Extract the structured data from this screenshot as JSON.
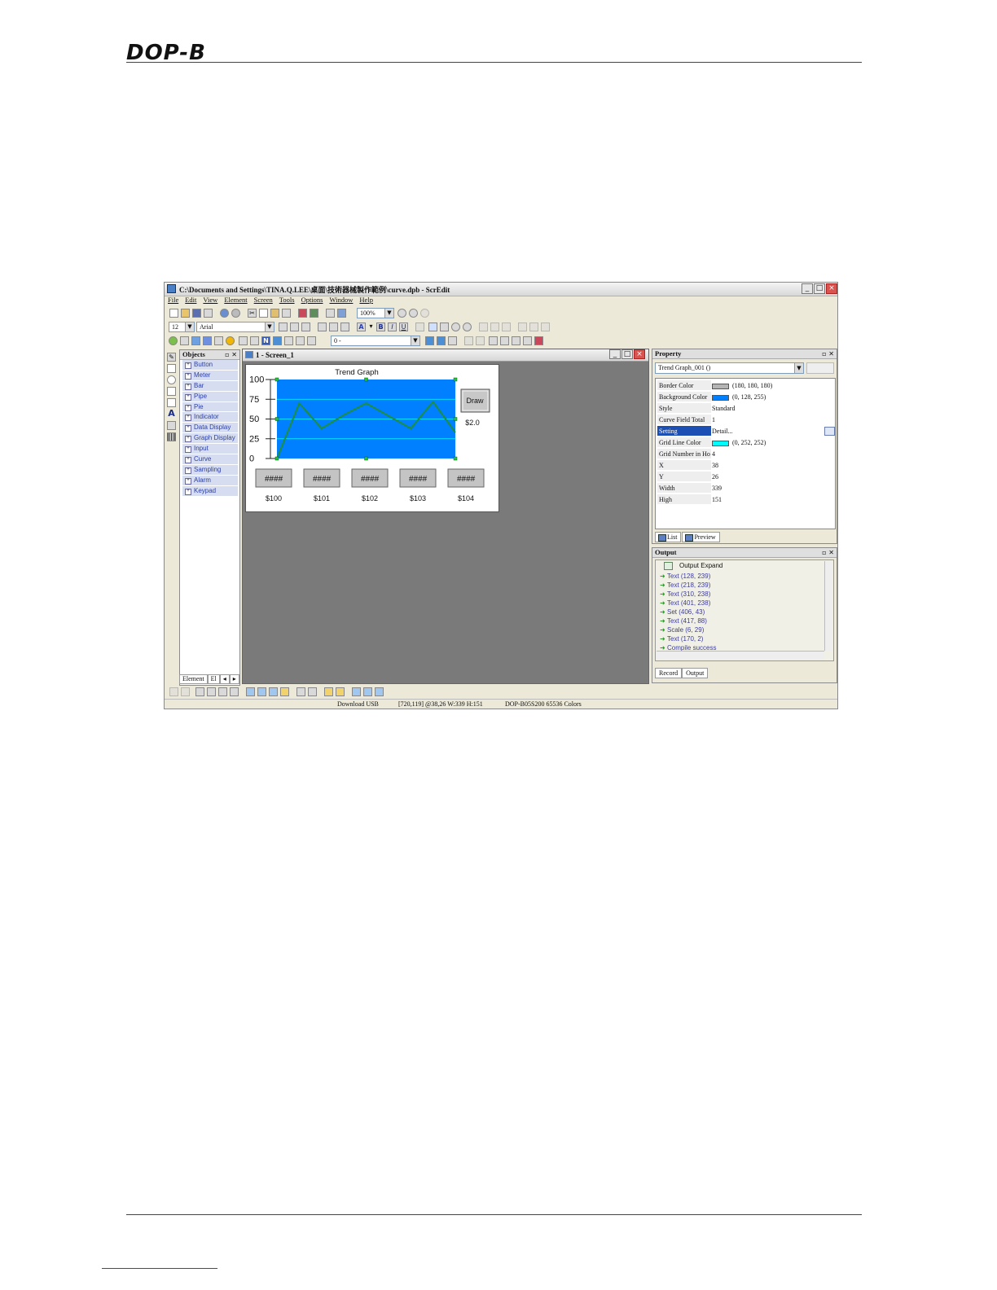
{
  "page": {
    "logo": "DOP-B"
  },
  "window": {
    "title": "C:\\Documents and Settings\\TINA.Q.LEE\\桌面\\技術器械製作範例\\curve.dpb - ScrEdit",
    "minimize": "_",
    "maximize": "□",
    "close": "×"
  },
  "menu": [
    "File",
    "Edit",
    "View",
    "Element",
    "Screen",
    "Tools",
    "Options",
    "Window",
    "Help"
  ],
  "toolbar": {
    "zoom_value": "100%",
    "font_size_value": "12",
    "font_name_value": "Arial",
    "state_value": "0 -",
    "bold": "B",
    "italic": "I",
    "underline": "U",
    "font_color": "A",
    "num": "N"
  },
  "objects_panel": {
    "title": "Objects",
    "items": [
      "Button",
      "Meter",
      "Bar",
      "Pipe",
      "Pie",
      "Indicator",
      "Data Display",
      "Graph Display",
      "Input",
      "Curve",
      "Sampling",
      "Alarm",
      "Keypad"
    ],
    "tab_element": "Element",
    "tab_more": "El"
  },
  "screen_window": {
    "title": "1 - Screen_1"
  },
  "trend_graph": {
    "title": "Trend Graph",
    "draw_button": "Draw",
    "draw_address": "$2.0",
    "displays": [
      {
        "value": "####",
        "address": "$100"
      },
      {
        "value": "####",
        "address": "$101"
      },
      {
        "value": "####",
        "address": "$102"
      },
      {
        "value": "####",
        "address": "$103"
      },
      {
        "value": "####",
        "address": "$104"
      }
    ],
    "background_color": "#0080ff",
    "grid_color": "#00fcfc",
    "curve_color": "#1f8f3a"
  },
  "chart_data": {
    "type": "line",
    "title": "Trend Graph",
    "yticks": [
      "100",
      "75",
      "50",
      "25",
      "0"
    ],
    "ylim": [
      0,
      100
    ],
    "x": [
      0,
      1,
      2,
      3,
      4,
      5,
      6,
      7,
      8
    ],
    "series": [
      {
        "values": [
          0,
          70,
          38,
          55,
          70,
          54,
          38,
          72,
          33
        ]
      }
    ]
  },
  "property_panel": {
    "title": "Property",
    "selected_object": "Trend Graph_001 ()",
    "rows": [
      {
        "key": "Border Color",
        "value": "(180, 180, 180)",
        "swatch": "#b4b4b4"
      },
      {
        "key": "Background Color",
        "value": "(0, 128, 255)",
        "swatch": "#0080ff"
      },
      {
        "key": "Style",
        "value": "Standard"
      },
      {
        "key": "Curve Field Total",
        "value": "1"
      },
      {
        "key": "Setting",
        "value": "Detail...",
        "selected": true
      },
      {
        "key": "Grid Line Color",
        "value": "(0, 252, 252)",
        "swatch": "#00fcfc"
      },
      {
        "key": "Grid Number in Ho",
        "value": "4"
      },
      {
        "key": "X",
        "value": "38"
      },
      {
        "key": "Y",
        "value": "26"
      },
      {
        "key": "Width",
        "value": "339"
      },
      {
        "key": "High",
        "value": "151"
      }
    ],
    "tab_list": "List",
    "tab_preview": "Preview"
  },
  "output_panel": {
    "title": "Output",
    "header": "Output Expand",
    "lines": [
      "Text (128, 239)",
      "Text (218, 239)",
      "Text (310, 238)",
      "Text (401, 238)",
      "Set (406, 43)",
      "Text (417, 88)",
      "Scale (6, 29)",
      "Text (170, 2)",
      "Compile success"
    ],
    "tab_record": "Record",
    "tab_output": "Output"
  },
  "status": {
    "download": "Download USB",
    "coords": "[720,119] @38,26 W:339 H:151",
    "model": "DOP-B05S200 65536 Colors"
  }
}
